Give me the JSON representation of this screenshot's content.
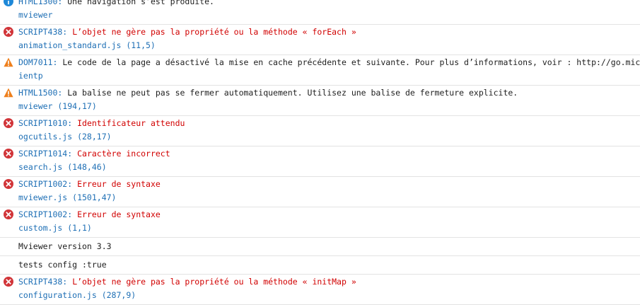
{
  "colors": {
    "error": "#d10000",
    "link": "#1e6fb5",
    "error_icon": "#d13438",
    "warning_icon": "#ee7f1c",
    "info_icon": "#1e88d8"
  },
  "entries": [
    {
      "type": "info",
      "icon": "info-icon",
      "code": "HTML1300:",
      "message": "Une navigation s’est produite.",
      "source": "mviewer"
    },
    {
      "type": "error",
      "icon": "error-icon",
      "code": "SCRIPT438:",
      "message": "L’objet ne gère pas la propriété ou la méthode « forEach »",
      "source": "animation_standard.js (11,5)"
    },
    {
      "type": "warning",
      "icon": "warning-icon",
      "code": "DOM7011:",
      "message": "Le code de la page a désactivé la mise en cache précédente et suivante. Pour plus d’informations, voir : http://go.microsoft",
      "source": "ientp"
    },
    {
      "type": "warning",
      "icon": "warning-icon",
      "code": "HTML1500:",
      "message": "La balise ne peut pas se fermer automatiquement. Utilisez une balise de fermeture explicite.",
      "source": "mviewer (194,17)"
    },
    {
      "type": "error",
      "icon": "error-icon",
      "code": "SCRIPT1010:",
      "message": "Identificateur attendu",
      "source": "ogcutils.js (28,17)"
    },
    {
      "type": "error",
      "icon": "error-icon",
      "code": "SCRIPT1014:",
      "message": "Caractère incorrect",
      "source": "search.js (148,46)"
    },
    {
      "type": "error",
      "icon": "error-icon",
      "code": "SCRIPT1002:",
      "message": "Erreur de syntaxe",
      "source": "mviewer.js (1501,47)"
    },
    {
      "type": "error",
      "icon": "error-icon",
      "code": "SCRIPT1002:",
      "message": "Erreur de syntaxe",
      "source": "custom.js (1,1)"
    },
    {
      "type": "log",
      "text": "Mviewer version 3.3"
    },
    {
      "type": "log",
      "text": "tests config :true"
    },
    {
      "type": "error",
      "icon": "error-icon",
      "code": "SCRIPT438:",
      "message": "L’objet ne gère pas la propriété ou la méthode « initMap »",
      "source": "configuration.js (287,9)"
    }
  ]
}
